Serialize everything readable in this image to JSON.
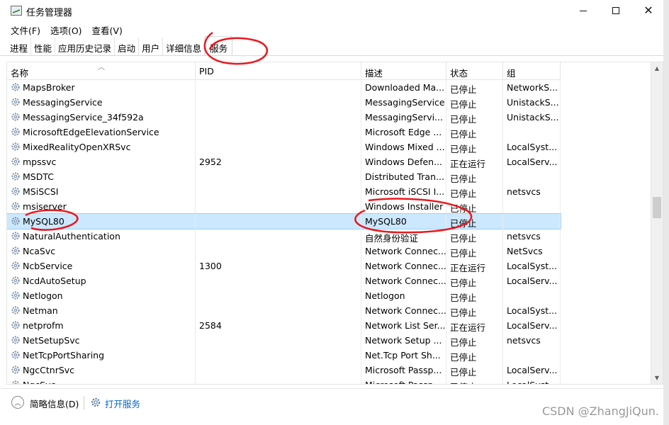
{
  "window": {
    "title": "任务管理器",
    "icon": "task-manager-icon"
  },
  "menu": {
    "items": [
      "文件(F)",
      "选项(O)",
      "查看(V)"
    ]
  },
  "tabs": {
    "items": [
      "进程",
      "性能",
      "应用历史记录",
      "启动",
      "用户",
      "详细信息",
      "服务"
    ],
    "active": "服务"
  },
  "table": {
    "headers": {
      "name": "名称",
      "pid": "PID",
      "desc": "描述",
      "status": "状态",
      "group": "组"
    },
    "rows": [
      {
        "name": "MapsBroker",
        "pid": "",
        "desc": "Downloaded Ma...",
        "status": "已停止",
        "group": "NetworkS..."
      },
      {
        "name": "MessagingService",
        "pid": "",
        "desc": "MessagingService",
        "status": "已停止",
        "group": "UnistackS..."
      },
      {
        "name": "MessagingService_34f592a",
        "pid": "",
        "desc": "MessagingServi...",
        "status": "已停止",
        "group": "UnistackS..."
      },
      {
        "name": "MicrosoftEdgeElevationService",
        "pid": "",
        "desc": "Microsoft Edge ...",
        "status": "已停止",
        "group": ""
      },
      {
        "name": "MixedRealityOpenXRSvc",
        "pid": "",
        "desc": "Windows Mixed ...",
        "status": "已停止",
        "group": "LocalSyst..."
      },
      {
        "name": "mpssvc",
        "pid": "2952",
        "desc": "Windows Defen...",
        "status": "正在运行",
        "group": "LocalServ..."
      },
      {
        "name": "MSDTC",
        "pid": "",
        "desc": "Distributed Tran...",
        "status": "已停止",
        "group": ""
      },
      {
        "name": "MSiSCSI",
        "pid": "",
        "desc": "Microsoft iSCSI I...",
        "status": "已停止",
        "group": "netsvcs"
      },
      {
        "name": "msiserver",
        "pid": "",
        "desc": "Windows Installer",
        "status": "已停止",
        "group": ""
      },
      {
        "name": "MySQL80",
        "pid": "",
        "desc": "MySQL80",
        "status": "已停止",
        "group": "",
        "selected": true
      },
      {
        "name": "NaturalAuthentication",
        "pid": "",
        "desc": "自然身份验证",
        "status": "已停止",
        "group": "netsvcs"
      },
      {
        "name": "NcaSvc",
        "pid": "",
        "desc": "Network Connec...",
        "status": "已停止",
        "group": "NetSvcs"
      },
      {
        "name": "NcbService",
        "pid": "1300",
        "desc": "Network Connec...",
        "status": "正在运行",
        "group": "LocalSyst..."
      },
      {
        "name": "NcdAutoSetup",
        "pid": "",
        "desc": "Network Connec...",
        "status": "已停止",
        "group": "LocalServ..."
      },
      {
        "name": "Netlogon",
        "pid": "",
        "desc": "Netlogon",
        "status": "已停止",
        "group": ""
      },
      {
        "name": "Netman",
        "pid": "",
        "desc": "Network Connec...",
        "status": "已停止",
        "group": "LocalSyst..."
      },
      {
        "name": "netprofm",
        "pid": "2584",
        "desc": "Network List Ser...",
        "status": "正在运行",
        "group": "LocalServ..."
      },
      {
        "name": "NetSetupSvc",
        "pid": "",
        "desc": "Network Setup ...",
        "status": "已停止",
        "group": "netsvcs"
      },
      {
        "name": "NetTcpPortSharing",
        "pid": "",
        "desc": "Net.Tcp Port Sh...",
        "status": "已停止",
        "group": ""
      },
      {
        "name": "NgcCtnrSvc",
        "pid": "",
        "desc": "Microsoft Passp...",
        "status": "已停止",
        "group": "LocalServ..."
      },
      {
        "name": "NgcSvc",
        "pid": "",
        "desc": "Microsoft Passp...",
        "status": "已停止",
        "group": "LocalSyst..."
      }
    ]
  },
  "footer": {
    "brief_info": "简略信息(D)",
    "open_services": "打开服务"
  },
  "watermark": "CSDN @ZhangJiQun."
}
